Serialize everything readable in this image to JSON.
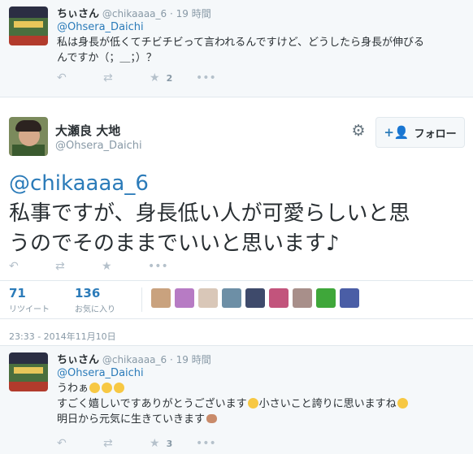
{
  "reply_top": {
    "name": "ちぃさん",
    "handle": "@chikaaaa_6",
    "time": "· 19 時間",
    "mention": "@Ohsera_Daichi",
    "text_line1": "私は身長が低くてチビチビって言われるんですけど、どうしたら身長が伸びる",
    "text_line2": "んですか（；＿；）？",
    "favorite_count": "2"
  },
  "main_tweet": {
    "name": "大瀬良 大地",
    "handle": "@Ohsera_Daichi",
    "follow_label": "フォロー",
    "mention": "@chikaaaa_6",
    "text_line1": "私事ですが、身長低い人が可愛らしいと思",
    "text_line2": "うのでそのままでいいと思います♪",
    "retweet_count": "71",
    "retweet_label": "リツイート",
    "favorite_count": "136",
    "favorite_label": "お気に入り",
    "timestamp": "23:33 - 2014年11月10日",
    "thumbnail_colors": [
      "#c9a27e",
      "#b77bc4",
      "#d9c7b8",
      "#6d8fa6",
      "#3e4a6b",
      "#c2547c",
      "#a88f8a",
      "#3fa73a",
      "#4a5ea6"
    ]
  },
  "reply_bottom": {
    "name": "ちぃさん",
    "handle": "@chikaaaa_6",
    "time": "· 19 時間",
    "mention": "@Ohsera_Daichi",
    "line1": "うわぁ",
    "line2a": "すごく嬉しいですありがとうございます",
    "line2b": "小さいこと誇りに思いますね",
    "line3": "明日から元気に生きていきます",
    "favorite_count": "3"
  },
  "icons": {
    "reply": "reply-icon",
    "retweet": "retweet-icon",
    "favorite": "star-icon",
    "more": "more-icon",
    "settings": "gear-icon",
    "follow": "add-person-icon"
  }
}
